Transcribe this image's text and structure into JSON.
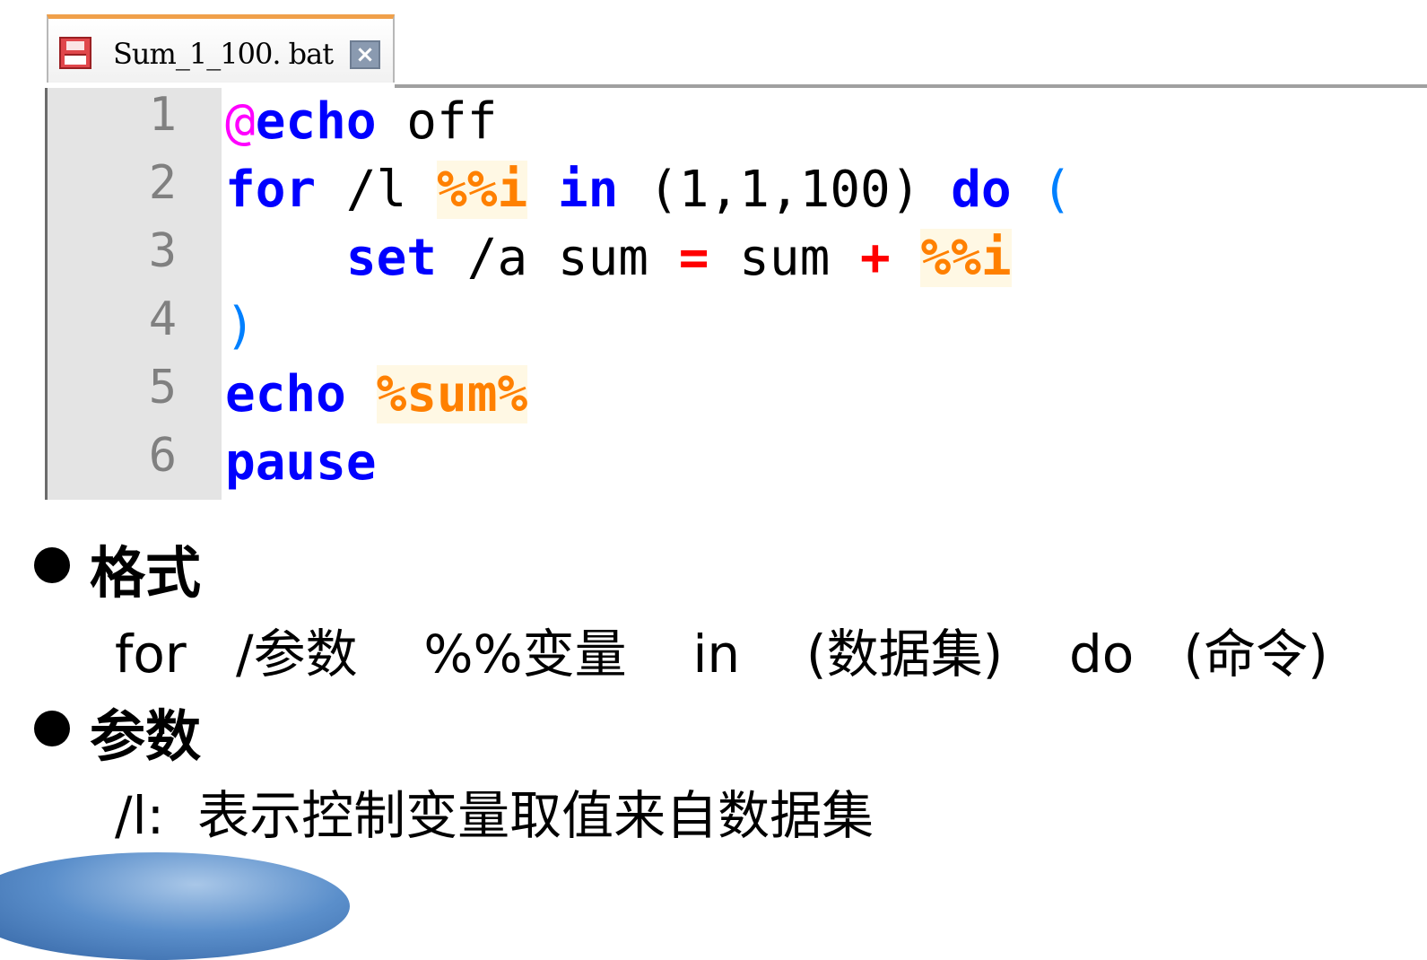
{
  "editor": {
    "tab": {
      "title": "Sum_1_100. bat",
      "close_label": "×"
    },
    "line_numbers": [
      "1",
      "2",
      "3",
      "4",
      "5",
      "6"
    ],
    "code": {
      "l1": {
        "at": "@",
        "echo": "echo",
        "off": " off"
      },
      "l2": {
        "for": "for",
        "switch": " /l ",
        "var": "%%i",
        "sp1": " ",
        "in": "in",
        "set": " (1,1,100) ",
        "do": "do",
        "sp2": " ",
        "paren": "("
      },
      "l3": {
        "indent": "    ",
        "set": "set",
        "mid": " /a sum ",
        "eq": "=",
        "sum2": " sum ",
        "plus": "+",
        "sp": " ",
        "var": "%%i"
      },
      "l4": {
        "paren": ")"
      },
      "l5": {
        "echo": "echo",
        "sp": " ",
        "var": "%sum%"
      },
      "l6": {
        "pause": "pause"
      }
    }
  },
  "notes": {
    "format_heading": "格式",
    "format_line": "for   /参数    %%变量    in    (数据集)    do   (命令)",
    "params_heading": "参数",
    "params_line": "/l:  表示控制变量取值来自数据集"
  }
}
